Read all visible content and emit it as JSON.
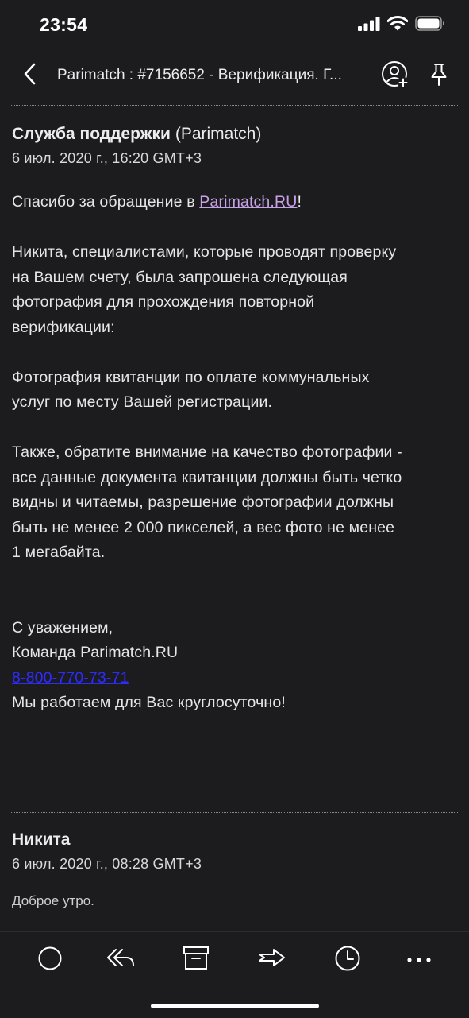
{
  "status_bar": {
    "time": "23:54"
  },
  "nav": {
    "subject": "Parimatch : #7156652 - Верификация. Г...",
    "icons": [
      "back-chevron-icon",
      "add-contact-icon",
      "pin-icon"
    ]
  },
  "message1": {
    "sender_name": "Служба поддержки",
    "sender_org": "(Parimatch)",
    "date": "6 июл. 2020 г., 16:20 GMT+3",
    "greeting_prefix": "Спасибо за обращение в ",
    "greeting_link": "Parimatch.RU",
    "greeting_suffix": "!",
    "paragraph1": "Никита, специалистами, которые проводят проверку\nна Вашем счету, была запрошена следующая\nфотография для прохождения повторной\nверификации:",
    "paragraph2": "Фотография квитанции по оплате коммунальных\nуслуг по месту Вашей регистрации.",
    "paragraph3": "Также, обратите внимание на качество фотографии -\nвсе данные документа квитанции должны быть четко\nвидны и читаемы, разрешение фотографии должны\nбыть не менее 2 000 пикселей, а вес фото не менее\n1 мегабайта.",
    "signoff": "С уважением,",
    "team": "Команда Parimatch.RU",
    "phone": "8-800-770-73-71",
    "hours": "Мы работаем для Вас круглосуточно!"
  },
  "message2": {
    "sender_name": "Никита",
    "date": "6 июл. 2020 г., 08:28 GMT+3",
    "preview": "Доброе утро."
  },
  "toolbar": {
    "icons": [
      "circle-icon",
      "reply-icon",
      "archive-icon",
      "forward-icon",
      "clock-icon",
      "more-icon"
    ]
  },
  "colors": {
    "background": "#1c1c1e",
    "text": "#e9e9eb",
    "link_purple": "#c8a2e8",
    "link_blue": "#2c2cff"
  }
}
